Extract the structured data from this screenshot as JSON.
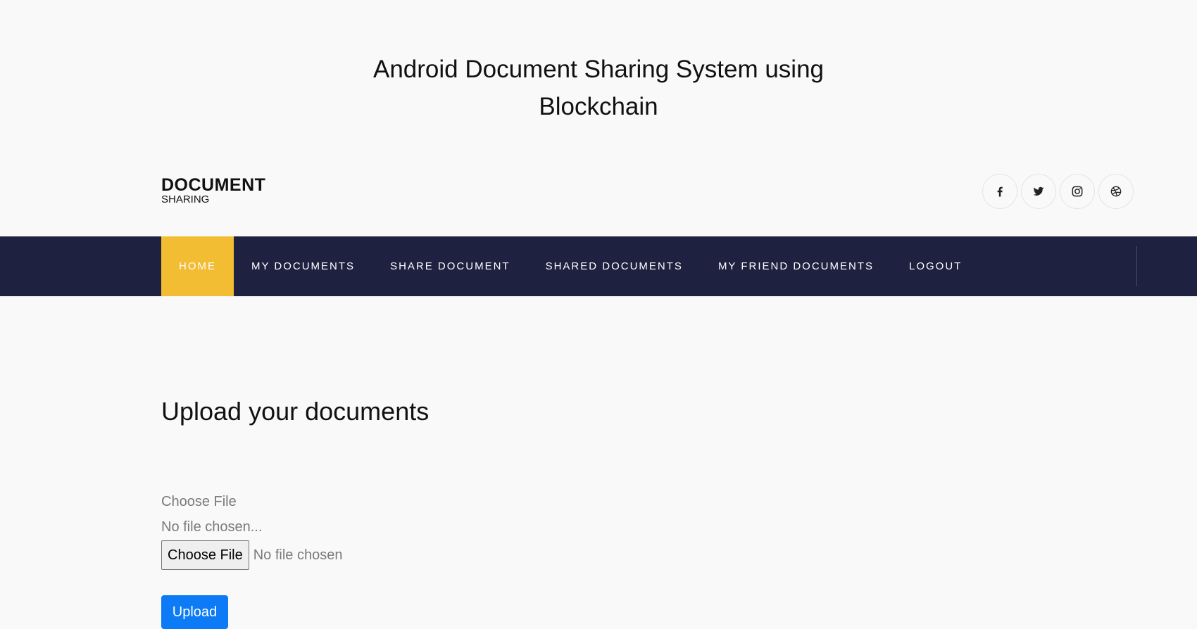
{
  "header": {
    "title_line1": "Android Document Sharing System using",
    "title_line2": "Blockchain"
  },
  "brand": {
    "title": "DOCUMENT",
    "subtitle": "SHARING"
  },
  "social": [
    {
      "icon": "facebook-icon"
    },
    {
      "icon": "twitter-icon"
    },
    {
      "icon": "instagram-icon"
    },
    {
      "icon": "dribbble-icon"
    }
  ],
  "nav": {
    "items": [
      {
        "label": "HOME",
        "active": true
      },
      {
        "label": "MY DOCUMENTS"
      },
      {
        "label": "SHARE DOCUMENT"
      },
      {
        "label": "SHARED DOCUMENTS"
      },
      {
        "label": "MY FRIEND DOCUMENTS"
      },
      {
        "label": "LOGOUT"
      }
    ],
    "active_color": "#f2bc33",
    "bar_color": "#1f2140"
  },
  "main": {
    "title": "Upload your documents",
    "file_label": "Choose File",
    "file_status": "No file chosen...",
    "choose_button": "Choose File",
    "file_chosen_text": "No file chosen",
    "upload_button": "Upload",
    "upload_color": "#0d7bf5"
  }
}
